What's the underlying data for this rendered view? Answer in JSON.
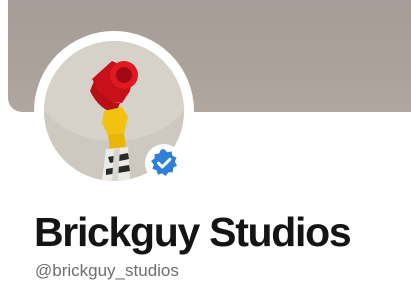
{
  "profile": {
    "display_name": "Brickguy Studios",
    "handle": "@brickguy_studios",
    "verified": true
  },
  "colors": {
    "banner": "#aba19b",
    "verified_badge": "#2f80d8",
    "name_text": "#141414",
    "handle_text": "#6e6e6e"
  },
  "icons": {
    "verified": "verified-badge-icon"
  }
}
